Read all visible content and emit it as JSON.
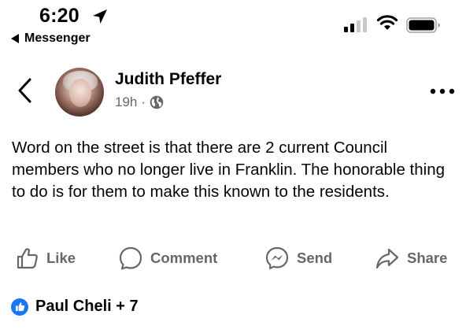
{
  "status_bar": {
    "time": "6:20",
    "back_app_label": "Messenger"
  },
  "post": {
    "author": "Judith Pfeffer",
    "time_ago": "19h",
    "separator": "·",
    "audience_icon": "globe-icon",
    "text": "Word on the street is that there are 2 current Council members who no longer live in Franklin. The honorable thing to do is for them to make this known to the residents."
  },
  "actions": {
    "like": "Like",
    "comment": "Comment",
    "send": "Send",
    "share": "Share"
  },
  "reactions": {
    "summary": "Paul Cheli + 7",
    "icon": "thumbs-up-icon"
  },
  "colors": {
    "secondary_text": "#65676b",
    "brand_blue": "#1877f2"
  }
}
